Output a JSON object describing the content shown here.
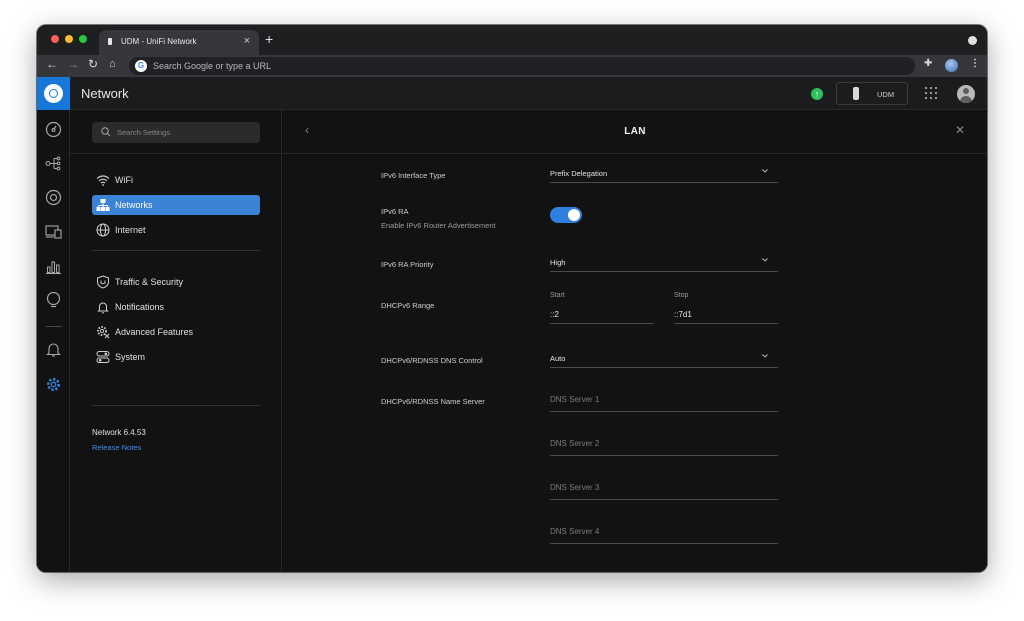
{
  "browser": {
    "tab_title": "UDM - UniFi Network",
    "tab_close": "×",
    "new_tab": "+",
    "omnibox_placeholder": "Search Google or type a URL",
    "google_letter": "G"
  },
  "header": {
    "app_title": "Network",
    "device_label": "UDM"
  },
  "settings_nav": {
    "search_placeholder": "Search Settings",
    "items": [
      {
        "label": "WiFi",
        "icon": "wifi-icon"
      },
      {
        "label": "Networks",
        "icon": "networks-icon",
        "active": true
      },
      {
        "label": "Internet",
        "icon": "globe-icon"
      },
      {
        "label": "Traffic & Security",
        "icon": "shield-icon"
      },
      {
        "label": "Notifications",
        "icon": "bell-icon"
      },
      {
        "label": "Advanced Features",
        "icon": "advanced-gear-icon"
      },
      {
        "label": "System",
        "icon": "system-toggle-icon"
      }
    ],
    "version": "Network 6.4.53",
    "release_notes": "Release Notes"
  },
  "panel": {
    "title": "LAN",
    "fields": {
      "ipv6_interface_type": {
        "label": "IPv6 Interface Type",
        "value": "Prefix Delegation"
      },
      "ipv6_ra": {
        "label": "IPv6 RA",
        "sublabel": "Enable IPv6 Router Advertisement",
        "enabled": true
      },
      "ipv6_ra_priority": {
        "label": "IPv6 RA Priority",
        "value": "High"
      },
      "dhcpv6_range": {
        "label": "DHCPv6 Range",
        "start_label": "Start",
        "start_value": "::2",
        "stop_label": "Stop",
        "stop_value": "::7d1"
      },
      "dns_control": {
        "label": "DHCPv6/RDNSS DNS Control",
        "value": "Auto"
      },
      "name_server": {
        "label": "DHCPv6/RDNSS Name Server",
        "placeholders": [
          "DNS Server 1",
          "DNS Server 2",
          "DNS Server 3",
          "DNS Server 4"
        ]
      }
    }
  },
  "colors": {
    "accent": "#3a83d6",
    "toggle_on": "#2f7fe0",
    "logo_blue": "#1778d9",
    "status_green": "#2fbf5b",
    "link_blue": "#3d8ef0"
  }
}
